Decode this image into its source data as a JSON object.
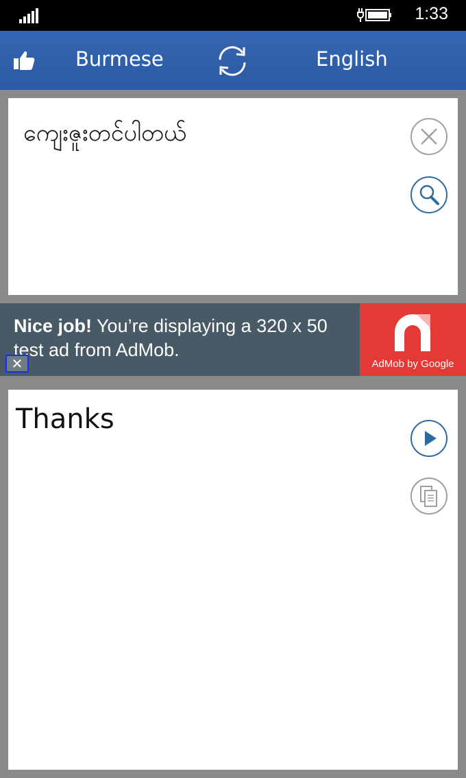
{
  "status_bar": {
    "time": "1:33",
    "signal_icon": "signal-bars-icon",
    "battery_icon": "battery-charging-icon"
  },
  "header": {
    "like_icon": "thumbs-up-icon",
    "source_language": "Burmese",
    "swap_icon": "swap-arrows-icon",
    "target_language": "English",
    "background_color": "#3163b0"
  },
  "input_panel": {
    "text": "ကျေးဇူးတင်ပါတယ်",
    "clear_icon": "close-icon",
    "search_icon": "search-icon"
  },
  "ad": {
    "headline": "Nice job!",
    "body": " You’re displaying a 320 x 50 test ad from AdMob.",
    "brand": "AdMob by Google",
    "close_icon": "close-icon",
    "brand_color": "#e53935",
    "background_color": "#475a66"
  },
  "output_panel": {
    "text": "Thanks",
    "play_icon": "play-icon",
    "copy_icon": "copy-icon"
  },
  "colors": {
    "accent": "#2c6aa0",
    "muted_button": "#9e9e9e"
  }
}
